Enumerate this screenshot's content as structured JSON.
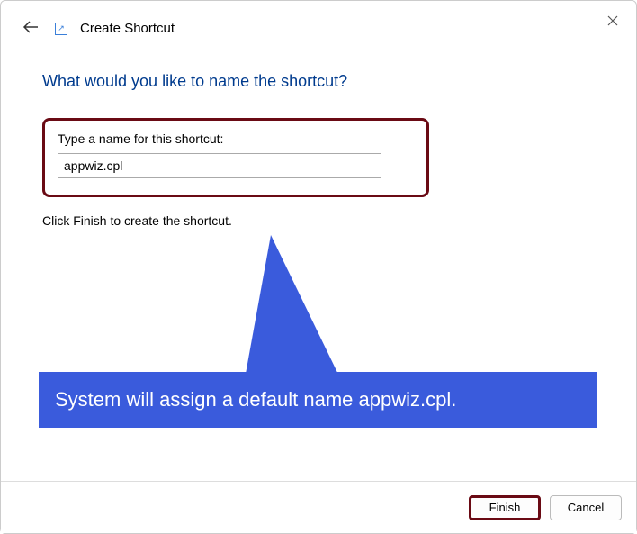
{
  "header": {
    "title": "Create Shortcut"
  },
  "main": {
    "heading": "What would you like to name the shortcut?",
    "field_label": "Type a name for this shortcut:",
    "input_value": "appwiz.cpl",
    "instruction": "Click Finish to create the shortcut."
  },
  "annotation": {
    "text": "System will assign a default name appwiz.cpl."
  },
  "footer": {
    "finish_label": "Finish",
    "cancel_label": "Cancel"
  }
}
